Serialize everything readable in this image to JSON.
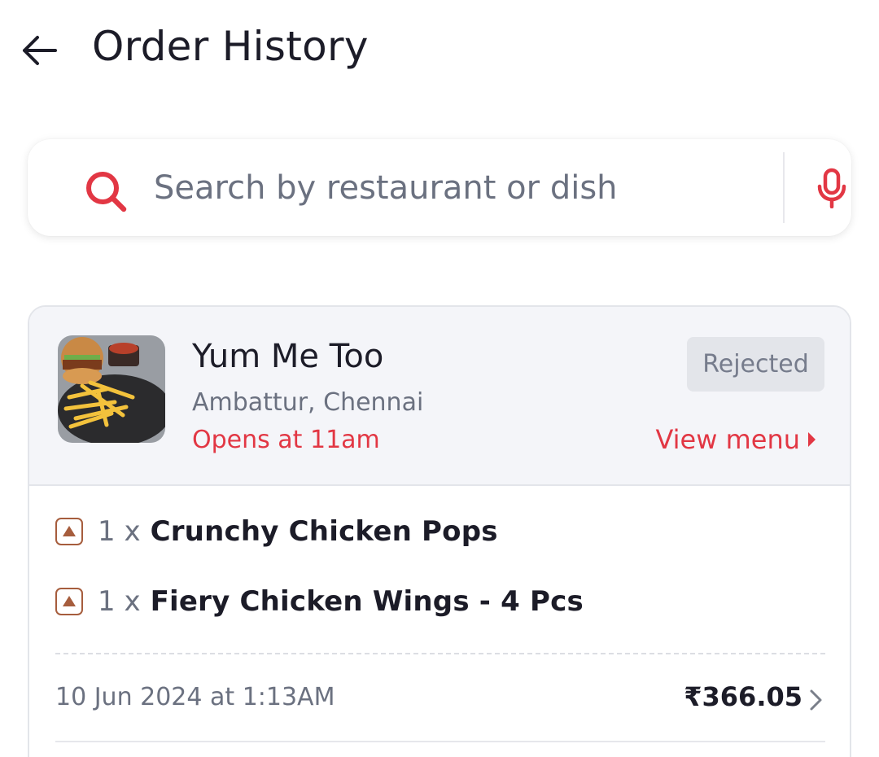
{
  "header": {
    "title": "Order History",
    "back_icon": "arrow-left-icon"
  },
  "search": {
    "placeholder": "Search by restaurant or dish",
    "value": "",
    "search_icon": "search-icon",
    "mic_icon": "microphone-icon"
  },
  "order": {
    "restaurant_name": "Yum Me Too",
    "location": "Ambattur, Chennai",
    "opens_text": "Opens at 11am",
    "status": "Rejected",
    "view_menu_label": "View menu",
    "items": [
      {
        "qty": "1 x",
        "name": "Crunchy Chicken Pops",
        "type_icon": "non-veg-icon"
      },
      {
        "qty": "1 x",
        "name": "Fiery Chicken Wings - 4 Pcs",
        "type_icon": "non-veg-icon"
      }
    ],
    "date": "10 Jun 2024 at 1:13AM",
    "total": "₹366.05"
  },
  "colors": {
    "accent": "#e23744",
    "text_primary": "#1c1c28",
    "text_secondary": "#6b7180",
    "card_top_bg": "#f4f5f9",
    "nonveg": "#a65d3d"
  }
}
